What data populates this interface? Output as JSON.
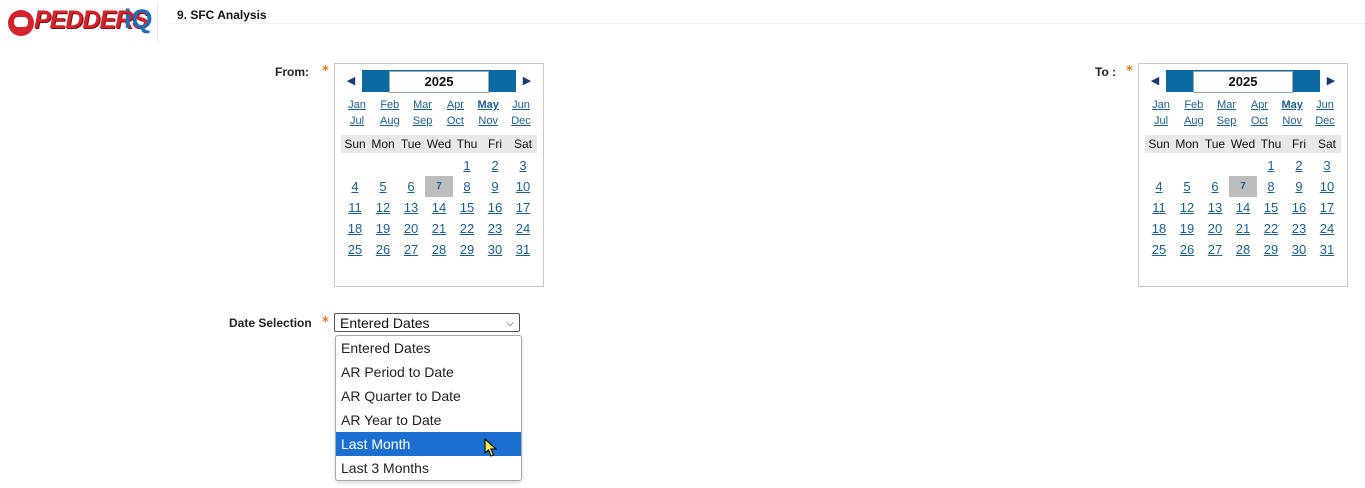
{
  "app": {
    "logo_text": "PEDDERS",
    "logo_suffix": "iQ"
  },
  "page": {
    "title": "9. SFC Analysis"
  },
  "from": {
    "label": "From:",
    "required_mark": "*"
  },
  "to": {
    "label": "To :",
    "required_mark": "*"
  },
  "calendar": {
    "year": "2025",
    "prev_icon": "◀",
    "next_icon": "▶",
    "months_row1": [
      "Jan",
      "Feb",
      "Mar",
      "Apr",
      "May",
      "Jun"
    ],
    "months_row2": [
      "Jul",
      "Aug",
      "Sep",
      "Oct",
      "Nov",
      "Dec"
    ],
    "selected_month": "May",
    "weekdays": [
      "Sun",
      "Mon",
      "Tue",
      "Wed",
      "Thu",
      "Fri",
      "Sat"
    ],
    "weeks": [
      [
        "",
        "",
        "",
        "",
        "1",
        "2",
        "3"
      ],
      [
        "4",
        "5",
        "6",
        "7",
        "8",
        "9",
        "10"
      ],
      [
        "11",
        "12",
        "13",
        "14",
        "15",
        "16",
        "17"
      ],
      [
        "18",
        "19",
        "20",
        "21",
        "22",
        "23",
        "24"
      ],
      [
        "25",
        "26",
        "27",
        "28",
        "29",
        "30",
        "31"
      ]
    ],
    "today": "7"
  },
  "date_selection": {
    "label": "Date Selection",
    "required_mark": "*",
    "value": "Entered Dates",
    "options": [
      "Entered Dates",
      "AR Period to Date",
      "AR Quarter to Date",
      "AR Year to Date",
      "Last Month",
      "Last 3 Months"
    ],
    "highlighted": "Last Month"
  },
  "colors": {
    "accent": "#0a6aa1",
    "link": "#1a5e96",
    "required": "#e0781c",
    "highlight": "#1a6fd0"
  }
}
